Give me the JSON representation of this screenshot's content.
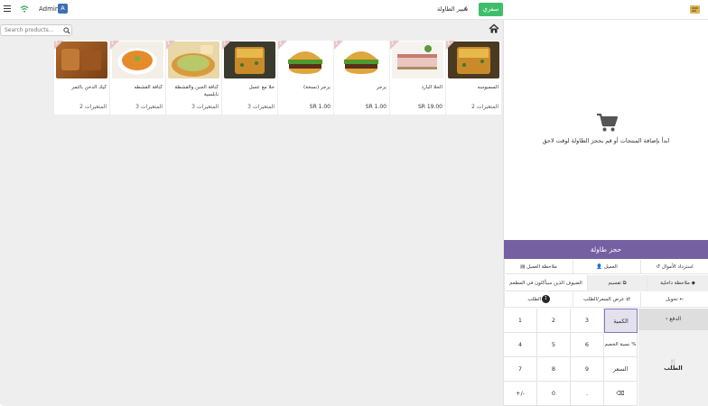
{
  "topbar": {
    "admin_name": "Admin",
    "admin_initial": "A",
    "change_table": "تغيير الطاولة",
    "send_button": "سفري"
  },
  "search": {
    "placeholder": "Search products..."
  },
  "products": [
    {
      "name": "السمبوسه",
      "meta": "2 المتغيرات",
      "badge": "1"
    },
    {
      "name": "الحلا البارد",
      "meta": "SR 19.00",
      "badge": "1"
    },
    {
      "name": "برجر",
      "meta": "SR 1.00",
      "badge": "1"
    },
    {
      "name": "برجر (نسخة)",
      "meta": "SR 1.00",
      "badge": "1"
    },
    {
      "name": "حلا مع عسل",
      "meta": "3 المتغيرات",
      "badge": "1"
    },
    {
      "name": "كنافة الجبن والقشطة نابلسية",
      "meta": "3 المتغيرات",
      "badge": "1"
    },
    {
      "name": "كنافة القشطه",
      "meta": "3 المتغيرات",
      "badge": "1"
    },
    {
      "name": "كيك الدخن بالتمر",
      "meta": "2 المتغيرات",
      "badge": "1"
    }
  ],
  "cart": {
    "empty_text": "ابدأ بإضافة المنتجات أو قم بحجز الطاولة لوقت لاحق"
  },
  "reserve_button": "حجز طاولة",
  "actions_row1": {
    "refund": "استرداد الأموال",
    "customer": "العميل",
    "customer_note": "ملاحظة العميل"
  },
  "actions_row2": {
    "internal_note": "ملاحظة داخلية",
    "split": "تقسيم",
    "guests": "الضيوف الذين سيأكلون في المطعم",
    "guests_count": "1"
  },
  "actions_row3": {
    "transfer": "تحويل",
    "show_prices": "عرض السعر/الطلب",
    "order_type": "نوع الطلب"
  },
  "numpad": {
    "keys": [
      "1",
      "2",
      "3",
      "4",
      "5",
      "6",
      "7",
      "8",
      "9",
      "+/-",
      "0",
      "."
    ],
    "quantity": "الكمية",
    "discount": "نسبة الخصم %",
    "price": "السعر",
    "backspace": "⌫"
  },
  "payment": {
    "pay_label": "الدفع",
    "order_label": "الطلب"
  },
  "colors": {
    "accent": "#7560a2",
    "send": "#3fbe6a",
    "avatar": "#3d6fb4"
  }
}
